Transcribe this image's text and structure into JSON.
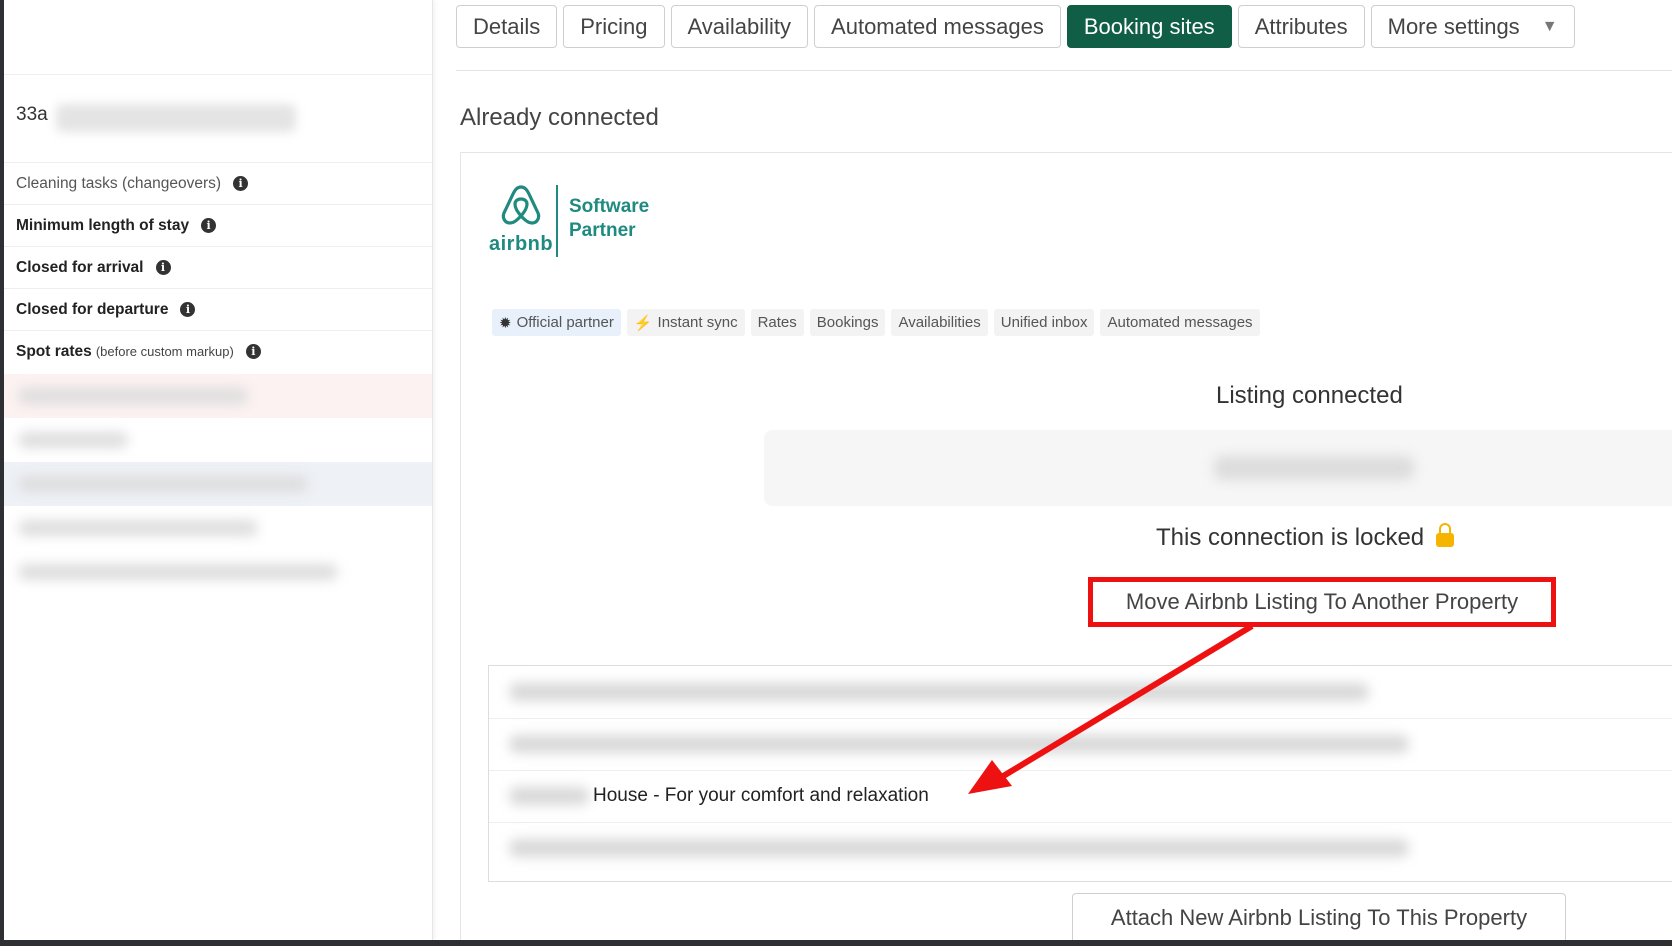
{
  "sidebar": {
    "property_prefix": "33a",
    "rows": [
      {
        "label": "Cleaning tasks (changeovers)",
        "extra": ""
      },
      {
        "label": "Minimum length of stay",
        "extra": ""
      },
      {
        "label": "Closed for arrival",
        "extra": ""
      },
      {
        "label": "Closed for departure",
        "extra": ""
      },
      {
        "label": "Spot rates",
        "extra": "(before custom markup)"
      }
    ]
  },
  "tabs": [
    {
      "label": "Details"
    },
    {
      "label": "Pricing"
    },
    {
      "label": "Availability"
    },
    {
      "label": "Automated messages"
    },
    {
      "label": "Booking sites",
      "active": true
    },
    {
      "label": "Attributes"
    },
    {
      "label": "More settings"
    }
  ],
  "main": {
    "section_title": "Already connected",
    "logo": {
      "word": "airbnb",
      "partner_line1": "Software",
      "partner_line2": "Partner"
    },
    "chips": [
      {
        "label": "Official partner",
        "icon": "badge-icon"
      },
      {
        "label": "Instant sync",
        "icon": "bolt-icon"
      },
      {
        "label": "Rates"
      },
      {
        "label": "Bookings"
      },
      {
        "label": "Availabilities"
      },
      {
        "label": "Unified inbox"
      },
      {
        "label": "Automated messages"
      }
    ],
    "listing_connected": "Listing connected",
    "locked_text": "This connection is locked",
    "move_button": "Move Airbnb Listing To Another Property",
    "listing_visible_label": "House - For your comfort and relaxation",
    "attach_button": "Attach New Airbnb Listing To This Property"
  },
  "colors": {
    "accent": "#0f5e45",
    "annotation": "#ee1111",
    "airbnb": "#1f8a80"
  }
}
